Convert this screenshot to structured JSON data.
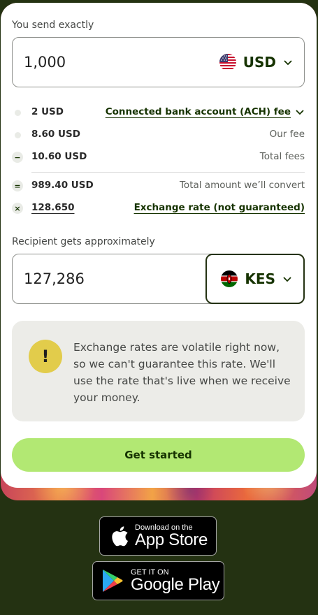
{
  "send": {
    "label": "You send exactly",
    "amount": "1,000",
    "currency": "USD",
    "flag_icon": "us-flag-icon"
  },
  "fees": [
    {
      "symbol": "",
      "amount": "2 USD",
      "label": "Connected bank account (ACH) fee",
      "label_style": "link-dropdown"
    },
    {
      "symbol": "",
      "amount": "8.60 USD",
      "label": "Our fee",
      "label_style": "plain"
    },
    {
      "symbol": "−",
      "amount": "10.60 USD",
      "label": "Total fees",
      "label_style": "plain"
    },
    {
      "symbol": "=",
      "amount": "989.40 USD",
      "label": "Total amount we’ll convert",
      "label_style": "plain"
    },
    {
      "symbol": "×",
      "amount": "128.650",
      "label": "Exchange rate (not guaranteed)",
      "label_style": "link"
    }
  ],
  "receive": {
    "label": "Recipient gets approximately",
    "amount": "127,286",
    "currency": "KES",
    "flag_icon": "kenya-flag-icon"
  },
  "alert": {
    "icon": "!",
    "text": "Exchange rates are volatile right now, so we can't guarantee this rate. We'll use the rate that's live when we receive your money."
  },
  "cta": {
    "label": "Get started"
  },
  "app_store": {
    "small": "Download on the",
    "big": "App Store"
  },
  "google_play": {
    "small": "GET IT ON",
    "big": "Google Play"
  },
  "colors": {
    "background": "#243212",
    "cta": "#b2e873",
    "alert_icon": "#e2cc4b",
    "brand_text": "#163300"
  }
}
